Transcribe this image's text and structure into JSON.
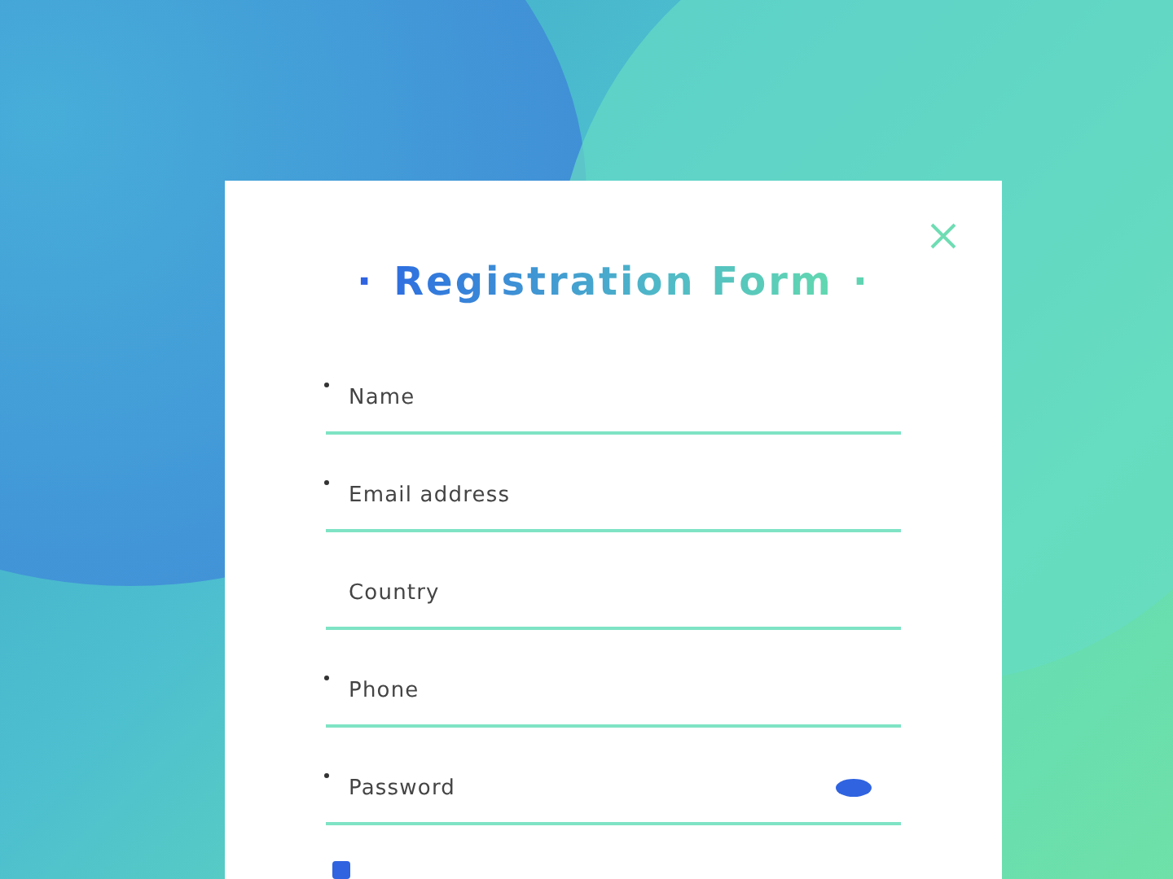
{
  "title": {
    "lead": "·",
    "text": "Registration Form",
    "trail": "·"
  },
  "fields": [
    {
      "placeholder": "Name",
      "required": true,
      "kind": "text"
    },
    {
      "placeholder": "Email address",
      "required": true,
      "kind": "text"
    },
    {
      "placeholder": "Country",
      "required": false,
      "kind": "text"
    },
    {
      "placeholder": "Phone",
      "required": true,
      "kind": "text"
    },
    {
      "placeholder": "Password",
      "required": true,
      "kind": "password"
    }
  ],
  "agreement": {
    "checked": true
  }
}
